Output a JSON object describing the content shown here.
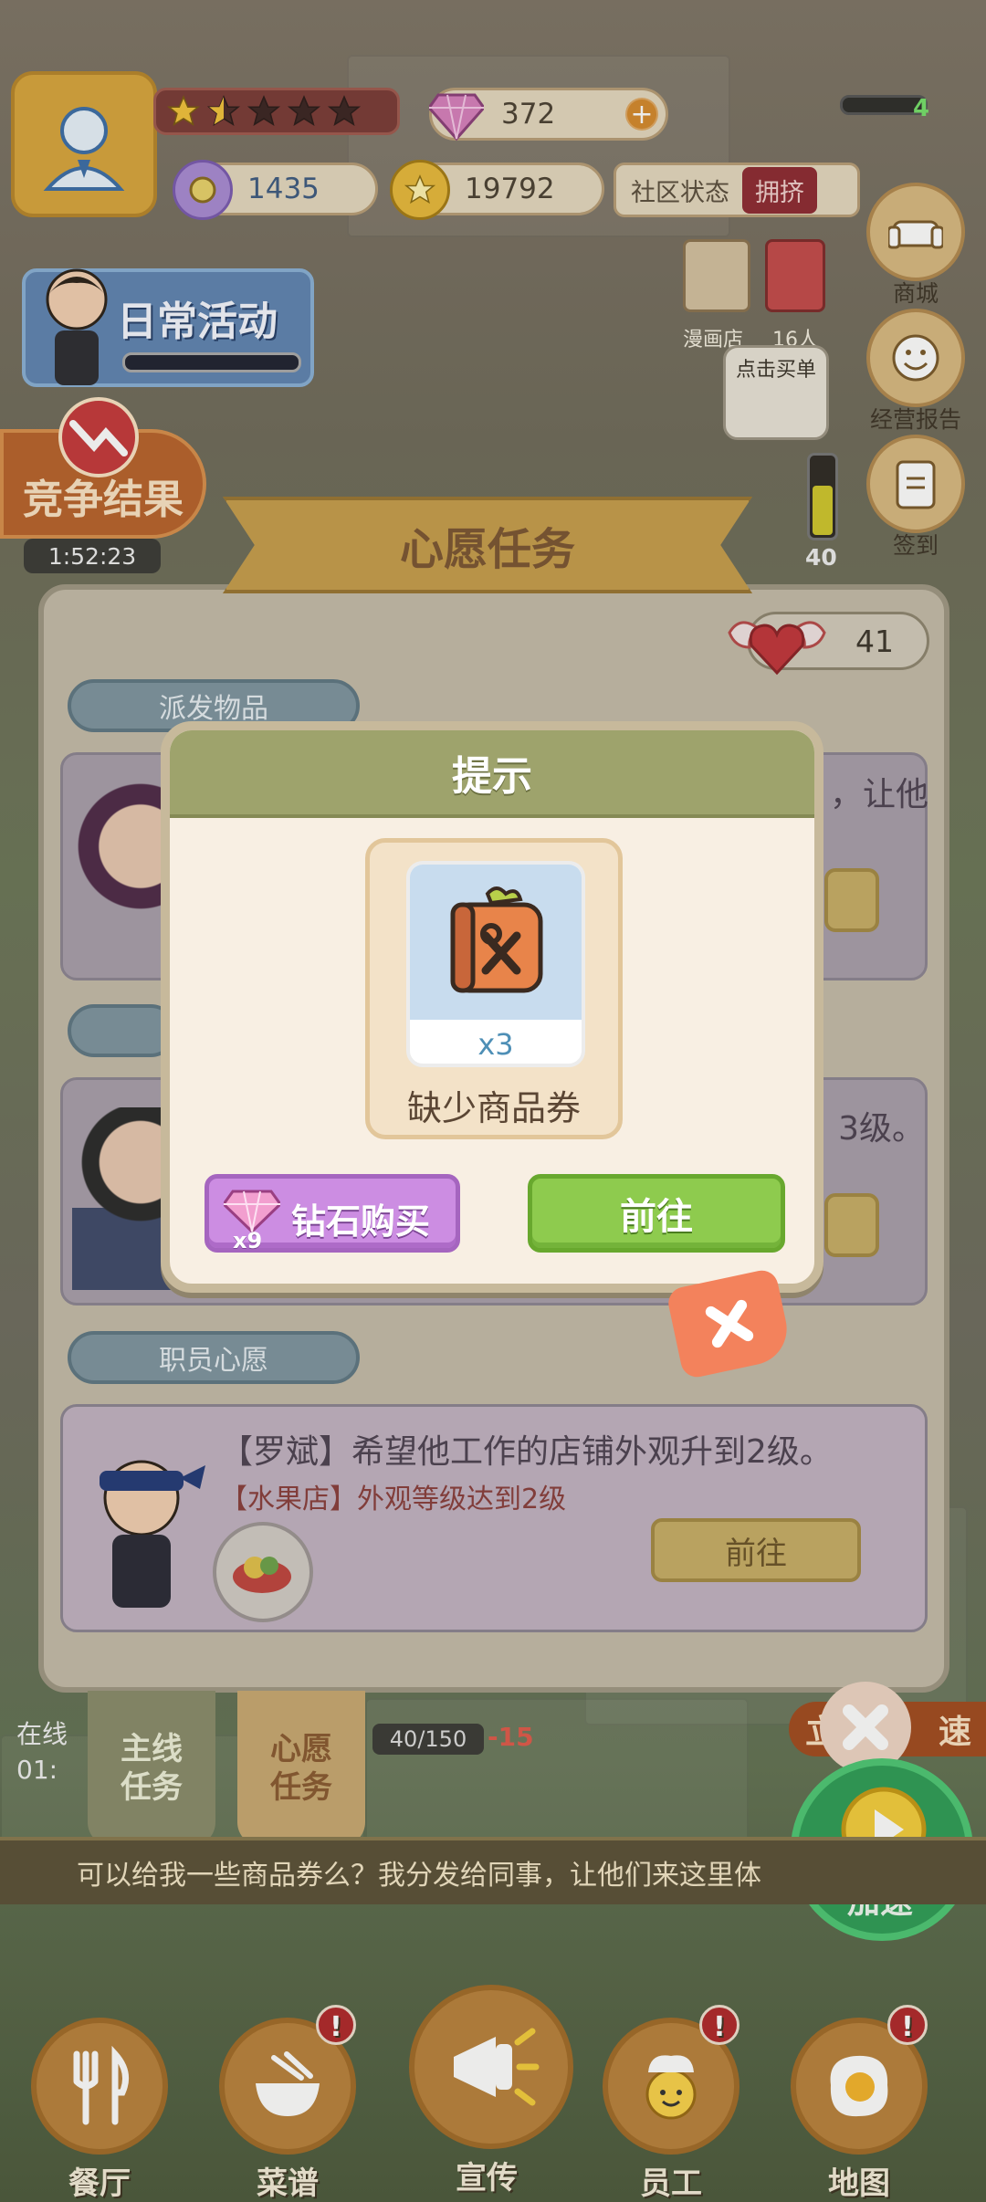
{
  "hud": {
    "diamonds": "372",
    "gems": "1435",
    "coins": "19792",
    "community_label": "社区状态",
    "community_status": "拥挤",
    "level_value": "4",
    "stars_filled": 1.5,
    "stars_total": 5
  },
  "left_side": {
    "daily_title": "日常活动",
    "compete_title": "竞争结果",
    "compete_timer": "1:52:23"
  },
  "right_side": {
    "mall_label": "商城",
    "report_label": "经营报告",
    "signin_label": "签到",
    "shop_name": "漫画店",
    "shop_people": "16人",
    "shop_hint": "点击买单",
    "energy": "40"
  },
  "wish_panel": {
    "title": "心愿任务",
    "hearts": "41",
    "section_dispatch": "派发物品",
    "section_staff": "职员心愿",
    "card1_text": "，让他",
    "card2_text": "3级。",
    "card3_line1": "【罗斌】希望他工作的店铺外观升到2级。",
    "card3_line2": "【水果店】外观等级达到2级",
    "go_label": "前往"
  },
  "bottom_tabs": {
    "main_task": "主线\n任务",
    "wish_task": "心愿\n任务"
  },
  "lower_hud": {
    "online_label": "在线",
    "online_time": "01:",
    "progress": "40/150",
    "delta": "-15",
    "speed_label": "加速",
    "speed_prefix": "立",
    "speed_suffix": "速",
    "scroll_message": "可以给我一些商品券么？我分发给同事，让他们来这里体"
  },
  "nav": [
    {
      "label": "餐厅",
      "alert": false
    },
    {
      "label": "菜谱",
      "alert": true
    },
    {
      "label": "宣传",
      "alert": false
    },
    {
      "label": "员工",
      "alert": true
    },
    {
      "label": "地图",
      "alert": true
    }
  ],
  "dialog": {
    "title": "提示",
    "item_qty": "x3",
    "item_name": "缺少商品券",
    "diamond_button": "钻石购买",
    "diamond_cost": "x9",
    "go_button": "前往",
    "alert_mark": "!"
  },
  "colors": {
    "dialog_header": "#9ea36c",
    "diamond_button": "#cc8de2",
    "go_button": "#8ecb4e",
    "close_button": "#f3825c"
  }
}
